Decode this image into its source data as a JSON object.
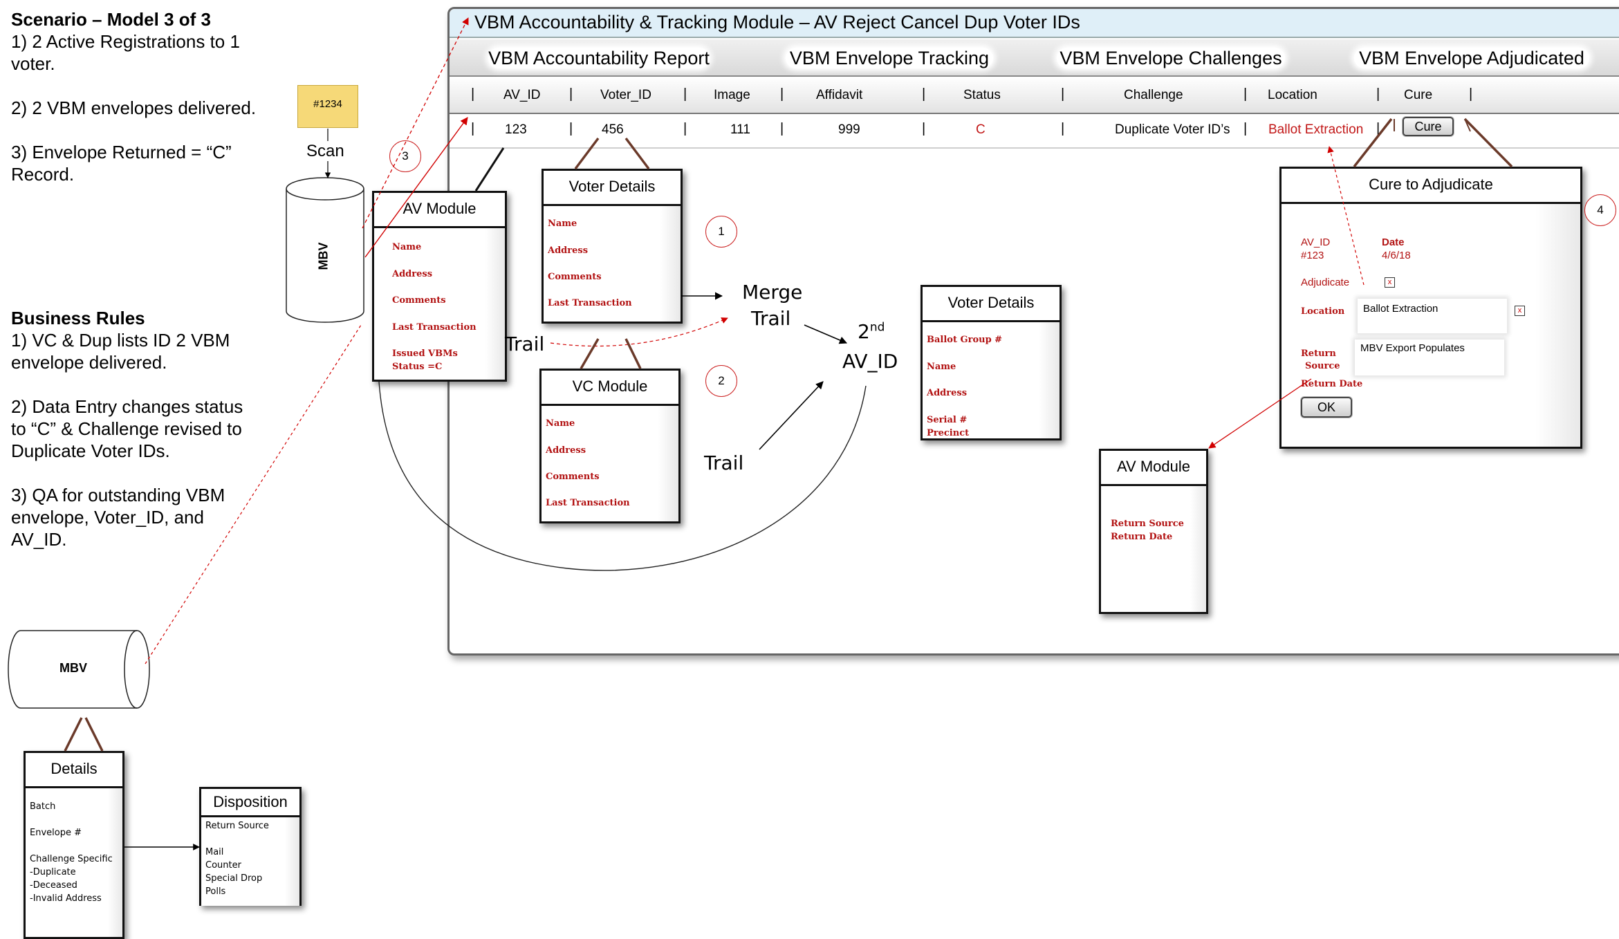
{
  "notes": {
    "scenario_title": "Scenario – Model 3 of 3",
    "scenario_lines": [
      "1) 2 Active Registrations  to 1 voter.",
      "2) 2 VBM envelopes delivered.",
      "3) Envelope Returned = “C” Record."
    ],
    "rules_title": "Business Rules",
    "rules_lines": [
      "1) VC & Dup lists ID 2 VBM envelope delivered.",
      "2) Data Entry changes status to “C” & Challenge revised to Duplicate Voter IDs.",
      "3) QA for outstanding VBM envelope, Voter_ID, and AV_ID."
    ]
  },
  "envelope": {
    "label": "#1234"
  },
  "scan_label": "Scan",
  "cylinders": {
    "top": "MBV",
    "bottom": "MBV"
  },
  "window": {
    "title": "VBM Accountability & Tracking Module – AV Reject Cancel Dup Voter IDs",
    "tabs": [
      "VBM Accountability Report",
      "VBM Envelope Tracking",
      "VBM Envelope Challenges",
      "VBM Envelope Adjudicated"
    ],
    "columns": [
      "AV_ID",
      "Voter_ID",
      "Image",
      "Affidavit",
      "Status",
      "Challenge",
      "Location",
      "Cure"
    ],
    "row": {
      "av_id": "123",
      "voter_id": "456",
      "image": "111",
      "affidavit": "999",
      "status": "C",
      "challenge": "Duplicate Voter ID’s",
      "location": "Ballot Extraction",
      "cure": "Cure"
    }
  },
  "av_module": {
    "title": "AV Module",
    "fields": [
      "Name",
      "Address",
      "Comments",
      "Last Transaction",
      "Issued VBMs",
      "Status =C"
    ]
  },
  "voter_details_1": {
    "title": "Voter Details",
    "fields": [
      "Name",
      "Address",
      "Comments",
      "Last Transaction"
    ]
  },
  "vc_module": {
    "title": "VC Module",
    "fields": [
      "Name",
      "Address",
      "Comments",
      "Last Transaction"
    ]
  },
  "voter_details_2": {
    "title": "Voter Details",
    "fields": [
      "Ballot Group #",
      "Name",
      "Address",
      "Serial #",
      "Precinct"
    ]
  },
  "av_module_2": {
    "title": "AV Module",
    "fields": [
      "Return Source",
      "Return Date"
    ]
  },
  "cure_dialog": {
    "title": "Cure to Adjudicate",
    "av_id_label": "AV_ID",
    "av_id_value": "#123",
    "date_label": "Date",
    "date_value": "4/6/18",
    "adjudicate_label": "Adjudicate",
    "location_label": "Location",
    "location_value": "Ballot Extraction",
    "return_source_label_1": "Return",
    "return_source_label_2": "Source",
    "return_source_value": "MBV Export Populates",
    "return_date_label": "Return Date",
    "ok_label": "OK"
  },
  "details": {
    "title": "Details",
    "lines": [
      "Batch",
      "Envelope #",
      "Challenge Specific",
      "-Duplicate",
      "-Deceased",
      "-Invalid Address"
    ]
  },
  "disposition": {
    "title": "Disposition",
    "lines": [
      "Return Source",
      "Mail",
      "Counter",
      "Special Drop",
      "Polls"
    ]
  },
  "flow_labels": {
    "trail_left": "Trail",
    "merge_1": "Merge",
    "merge_2": "Trail",
    "second": "2",
    "second_sup": "nd",
    "second_2": "AV_ID",
    "trail_bottom": "Trail"
  },
  "step_circles": [
    "1",
    "2",
    "3",
    "4"
  ],
  "colors": {
    "accent_red": "#b21212",
    "envelope_yellow": "#f6d978",
    "title_bar": "#dfeff8"
  }
}
